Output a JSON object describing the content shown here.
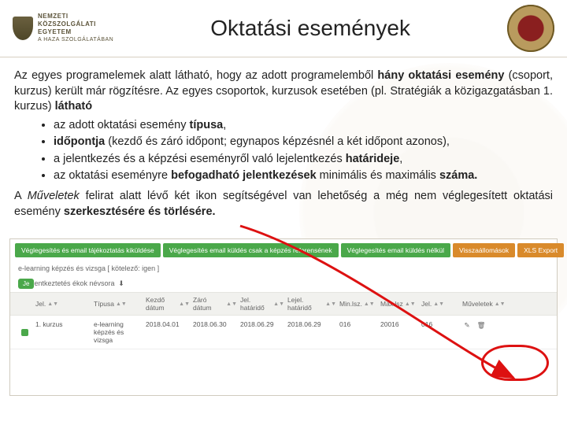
{
  "header": {
    "logo": {
      "l1": "NEMZETI",
      "l2": "KÖZSZOLGÁLATI",
      "l3": "EGYETEM",
      "l4": "A HAZA SZOLGÁLATÁBAN"
    },
    "title": "Oktatási események"
  },
  "body": {
    "p1a": "Az egyes programelemek alatt látható, hogy az adott programelemből ",
    "p1b": "hány oktatási esemény",
    "p1c": " (csoport, kurzus) került már rögzítésre. Az  egyes csoportok, kurzusok esetében (pl. Stratégiák a közigazgatásban 1. kurzus) ",
    "p1d": "látható",
    "li1a": "az adott oktatási esemény ",
    "li1b": "típusa",
    "li2a": "időpontja ",
    "li2b": "(kezdő és záró időpont; egynapos képzésnél a két időpont azonos),",
    "li3a": "a jelentkezés és a képzési eseményről való lejelentkezés ",
    "li3b": "határideje",
    "li4a": "az oktatási eseményre ",
    "li4b": "befogadható jelentkezések",
    "li4c": " minimális és maximális ",
    "li4d": "száma.",
    "p2a": "A ",
    "p2b": "Műveletek",
    "p2c": " felirat   alatt lévő két ikon segítségével van lehetőség a még nem véglegesített oktatási esemény ",
    "p2d": "szerkesztésére és törlésére."
  },
  "shot": {
    "tabs": [
      "Véglegesítés és email tájékoztatás kiküldése",
      "Véglegesítés email küldés csak a képzés referensének",
      "Véglegesítés email küldés nélkül",
      "Visszaállomások",
      "XLS Export"
    ],
    "meta": "e-learning képzés és vizsga [ kötelező: igen ]",
    "pill": "Je",
    "pillText": "entkeztetés ékok névsora",
    "cols": [
      "",
      "Jel.",
      "Típusa",
      "Kezdő dátum",
      "Záró dátum",
      "Jel. határidő",
      "Lejel. határidő",
      "Min.lsz.",
      "Max.lsz",
      "Jel.",
      "Műveletek"
    ],
    "row": {
      "name": "1. kurzus",
      "type": "e-learning képzés és vizsga",
      "d1": "2018.04.01",
      "d2": "2018.06.30",
      "d3": "2018.06.29",
      "d4": "2018.06.29",
      "min": "016",
      "max": "20016",
      "jel": "016"
    }
  }
}
